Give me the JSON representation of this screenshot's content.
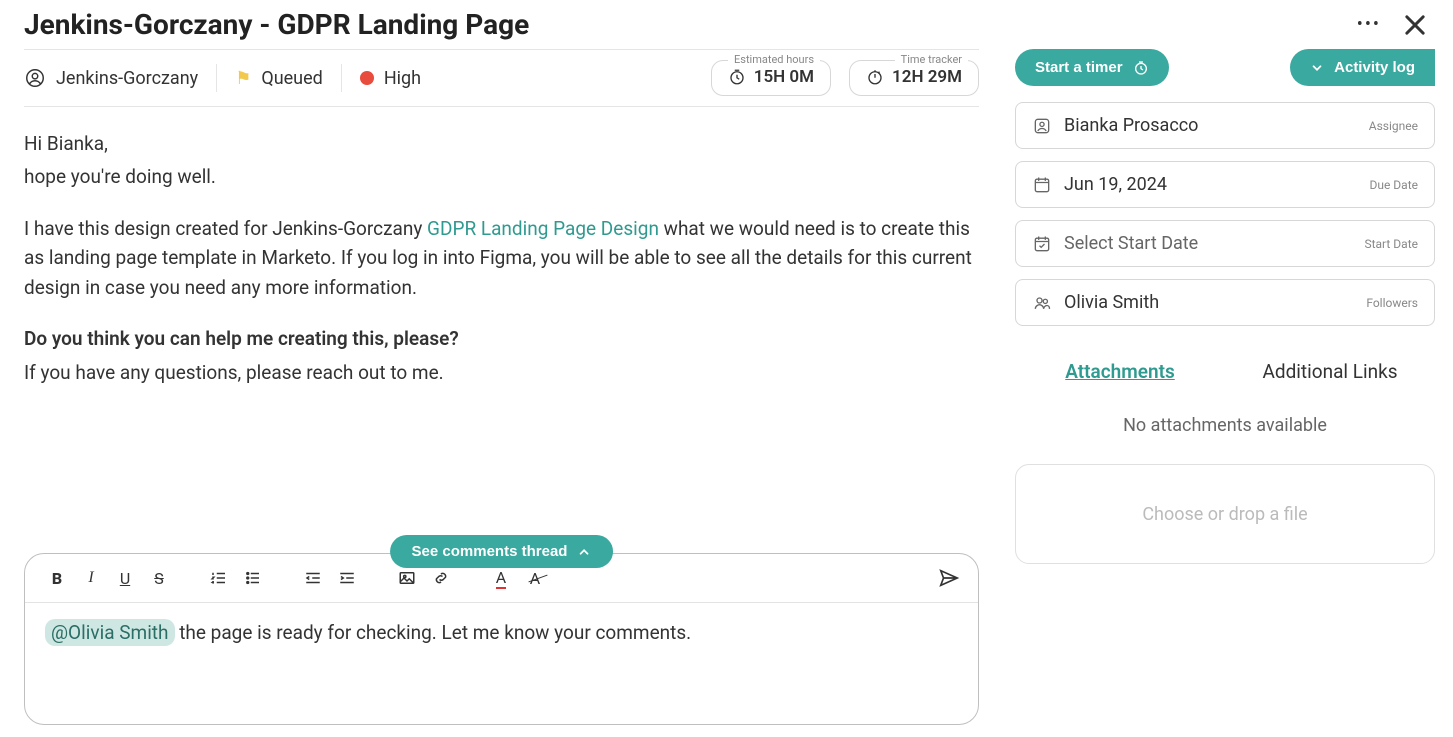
{
  "header": {
    "title": "Jenkins-Gorczany - GDPR Landing Page"
  },
  "meta": {
    "client": "Jenkins-Gorczany",
    "status": "Queued",
    "priority": "High",
    "estimated_label": "Estimated hours",
    "estimated_value": "15H 0M",
    "tracker_label": "Time tracker",
    "tracker_value": "12H 29M"
  },
  "description": {
    "greeting1": "Hi Bianka,",
    "greeting2": "hope you're doing well.",
    "body_pre": "I have this design created for Jenkins-Gorczany ",
    "link_text": "GDPR Landing Page Design",
    "body_post": " what we would need is to create this as landing page template in Marketo. If you log in into Figma, you will be able to see all the details for this current design in case you need any more information.",
    "question": "Do you think you can help me creating this, please?",
    "closing": "If you have any questions, please reach out to me."
  },
  "comments": {
    "thread_button": "See comments thread",
    "mention": "@Olivia Smith",
    "draft_text": " the page is ready for checking. Let me know your comments."
  },
  "sidebar": {
    "timer_button": "Start a timer",
    "activity_button": "Activity log",
    "assignee": {
      "value": "Bianka Prosacco",
      "label": "Assignee"
    },
    "due": {
      "value": "Jun 19, 2024",
      "label": "Due Date"
    },
    "start": {
      "value": "Select Start Date",
      "label": "Start Date"
    },
    "followers": {
      "value": "Olivia Smith",
      "label": "Followers"
    },
    "tabs": {
      "attachments": "Attachments",
      "links": "Additional Links"
    },
    "no_attachments": "No attachments available",
    "dropzone": "Choose or drop a file"
  }
}
